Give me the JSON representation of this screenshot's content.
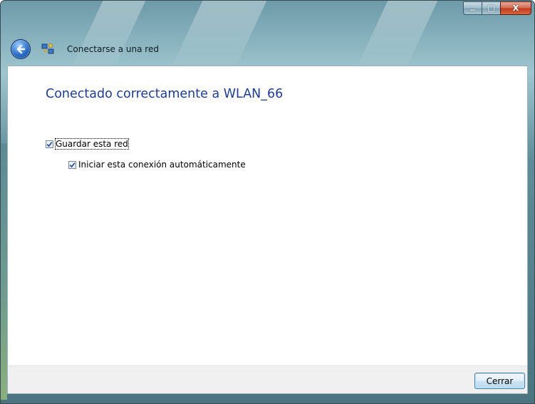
{
  "window": {
    "title": "Conectarse a una red",
    "caption": {
      "minimize": "—",
      "maximize": "□",
      "close": "X"
    }
  },
  "content": {
    "heading": "Conectado correctamente a WLAN_66",
    "save_network": {
      "label": "Guardar esta red",
      "checked": true
    },
    "auto_connect": {
      "label": "Iniciar esta conexión automáticamente",
      "checked": true
    }
  },
  "footer": {
    "close_button": "Cerrar"
  },
  "icons": {
    "back": "back-arrow-icon",
    "network": "network-connection-icon"
  }
}
